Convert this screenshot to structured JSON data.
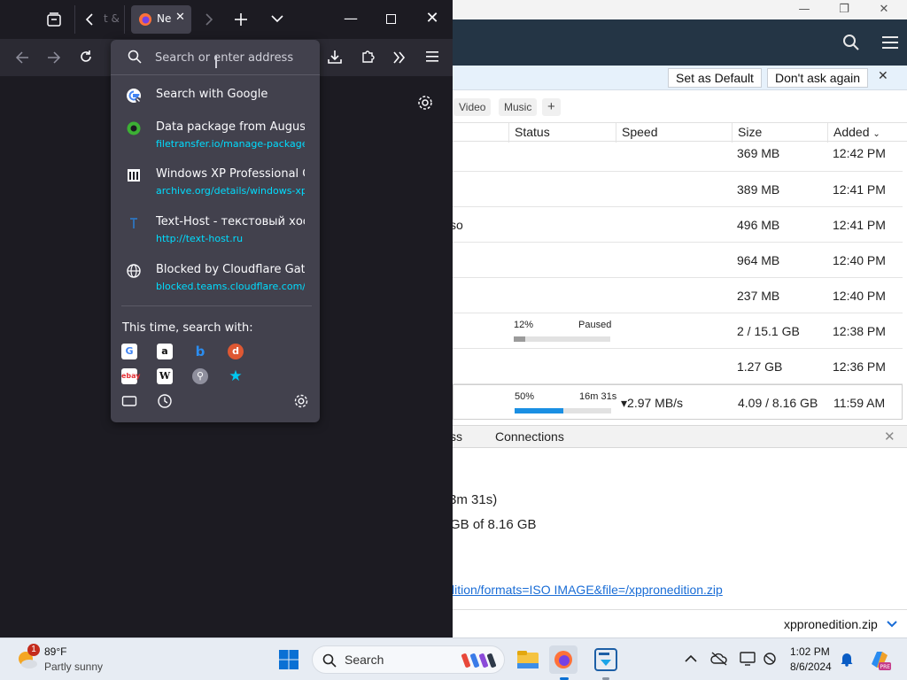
{
  "colors": {
    "ff_bg": "#1c1b22",
    "ff_toolbar": "#2b2a33",
    "ff_panel": "#42414d",
    "ff_url": "#00ddff",
    "progress_blue": "#1a8fe3",
    "progress_grey": "#9b9b9b",
    "dm_toolbar": "#243545",
    "link_blue": "#1a6dd6"
  },
  "firefox": {
    "tabs": [
      {
        "label": "t &"
      },
      {
        "label": "Ne"
      }
    ],
    "url_placeholder": "Search or enter address",
    "suggestions": [
      {
        "title": "Search with Google",
        "url": "",
        "icon": "google-icon"
      },
      {
        "title": "Data package from August",
        "url": "filetransfer.io/manage-package",
        "icon": "green-circle-icon"
      },
      {
        "title": "Windows XP Professional C",
        "url": "archive.org/details/windows-xp",
        "icon": "archive-icon"
      },
      {
        "title": "Text-Host - текстовый хост",
        "url": "http://text-host.ru",
        "icon": "text-host-icon"
      },
      {
        "title": "Blocked by Cloudflare Gate",
        "url": "blocked.teams.cloudflare.com/",
        "icon": "globe-icon"
      }
    ],
    "search_with_label": "This time, search with:"
  },
  "dm": {
    "notification": {
      "set_default": "Set as Default",
      "dont_ask": "Don't ask again"
    },
    "categories": [
      "Video",
      "Music"
    ],
    "columns": {
      "status": "Status",
      "speed": "Speed",
      "size": "Size",
      "added": "Added"
    },
    "rows": [
      {
        "size": "369 MB",
        "added": "12:42 PM"
      },
      {
        "size": "389 MB",
        "added": "12:41 PM"
      },
      {
        "partial": "so",
        "size": "496 MB",
        "added": "12:41 PM"
      },
      {
        "size": "964 MB",
        "added": "12:40 PM"
      },
      {
        "size": "237 MB",
        "added": "12:40 PM"
      },
      {
        "pct": "12%",
        "state": "Paused",
        "progress": 0.12,
        "size": "2 / 15.1 GB",
        "added": "12:38 PM"
      },
      {
        "size": "1.27 GB",
        "added": "12:36 PM"
      },
      {
        "pct": "50%",
        "state": "16m 31s",
        "progress": 0.5,
        "speed": "▾2.97 MB/s",
        "size": "4.09 / 8.16 GB",
        "added": "11:59 AM"
      }
    ],
    "detail_tabs": {
      "partial": "ss",
      "connections": "Connections"
    },
    "detail": {
      "eta_partial": "3m 31s)",
      "size_partial": "GB of 8.16 GB",
      "link_partial": "lition/formats=ISO IMAGE&file=/xppronedition.zip"
    },
    "status_file": "xppronedition.zip"
  },
  "taskbar": {
    "weather_temp": "89°F",
    "weather_desc": "Partly sunny",
    "weather_badge": "1",
    "search_label": "Search",
    "time": "1:02 PM",
    "date": "8/6/2024"
  }
}
